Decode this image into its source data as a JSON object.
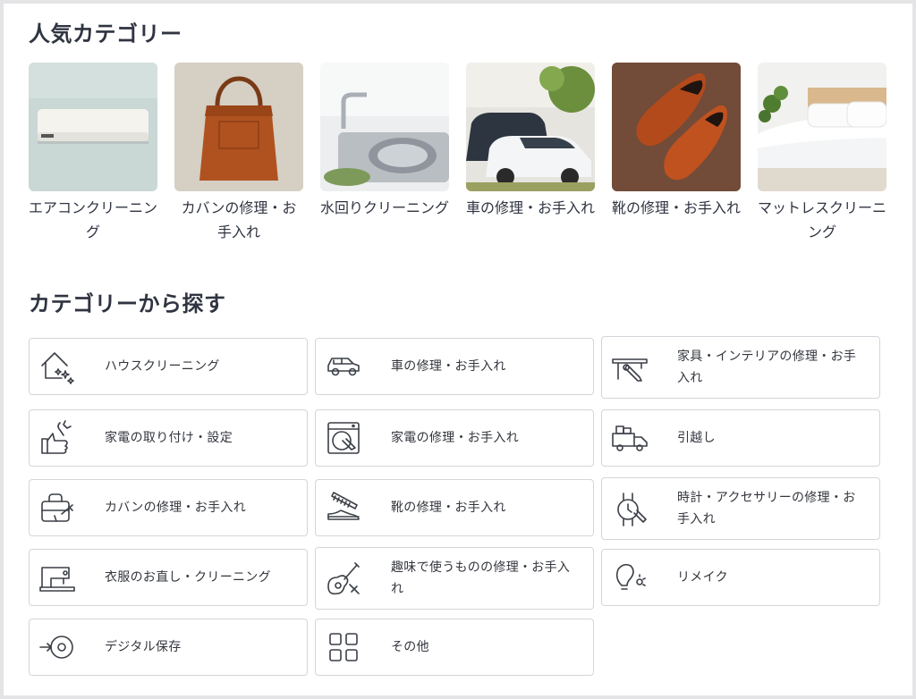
{
  "popular": {
    "title": "人気カテゴリー",
    "items": [
      {
        "label": "エアコンクリーニング",
        "icon": "air-conditioner-photo"
      },
      {
        "label": "カバンの修理・お手入れ",
        "icon": "leather-bag-photo"
      },
      {
        "label": "水回りクリーニング",
        "icon": "kitchen-sink-photo"
      },
      {
        "label": "車の修理・お手入れ",
        "icon": "cars-photo"
      },
      {
        "label": "靴の修理・お手入れ",
        "icon": "leather-shoes-photo"
      },
      {
        "label": "マットレスクリーニング",
        "icon": "bed-mattress-photo"
      }
    ]
  },
  "categories": {
    "title": "カテゴリーから探す",
    "items": [
      {
        "label": "ハウスクリーニング",
        "icon": "house-sparkle-icon"
      },
      {
        "label": "車の修理・お手入れ",
        "icon": "car-icon"
      },
      {
        "label": "家具・インテリアの修理・お手入れ",
        "icon": "furniture-repair-icon"
      },
      {
        "label": "家電の取り付け・設定",
        "icon": "thumbs-up-wrench-icon"
      },
      {
        "label": "家電の修理・お手入れ",
        "icon": "washing-machine-icon"
      },
      {
        "label": "引越し",
        "icon": "moving-truck-icon"
      },
      {
        "label": "カバンの修理・お手入れ",
        "icon": "bag-repair-icon"
      },
      {
        "label": "靴の修理・お手入れ",
        "icon": "shoe-brush-icon"
      },
      {
        "label": "時計・アクセサリーの修理・お手入れ",
        "icon": "watch-repair-icon"
      },
      {
        "label": "衣服のお直し・クリーニング",
        "icon": "sewing-machine-icon"
      },
      {
        "label": "趣味で使うものの修理・お手入れ",
        "icon": "guitar-repair-icon"
      },
      {
        "label": "リメイク",
        "icon": "remake-bulb-icon"
      },
      {
        "label": "デジタル保存",
        "icon": "disc-save-icon"
      },
      {
        "label": "その他",
        "icon": "grid-others-icon"
      }
    ]
  },
  "colors": {
    "text": "#2f3440",
    "card_border": "#d3d5da",
    "background": "#ffffff"
  }
}
